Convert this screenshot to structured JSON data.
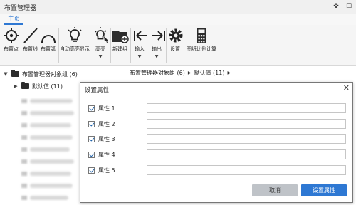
{
  "app": {
    "title": "布置管理器",
    "controls": {
      "pin": "✜",
      "restore": "☐"
    }
  },
  "ribbon_tab": "主页",
  "ribbon": {
    "place_point": "布置点",
    "place_line": "布置线",
    "place_arc": "布置弧",
    "auto_highlight": "自动高亮显示",
    "highlight": "高亮",
    "new_group": "新建组",
    "import": "输入",
    "export": "输出",
    "settings": "设置",
    "drawing_scale": "图纸比例计算",
    "dropdown_glyph": "▼"
  },
  "tree": {
    "root_label": "布置管理器对象组 (6)",
    "child_label": "默认值 (11)",
    "expanded_glyph": "▼",
    "collapsed_glyph": "▶"
  },
  "breadcrumb": {
    "segments": [
      "布置管理器对象组 (6)",
      "默认值 (11)"
    ],
    "separator": "▶"
  },
  "dialog": {
    "title": "设置属性",
    "close": "✕",
    "properties": [
      {
        "label": "属性 1",
        "checked": true,
        "value": ""
      },
      {
        "label": "属性 2",
        "checked": true,
        "value": ""
      },
      {
        "label": "属性 3",
        "checked": true,
        "value": ""
      },
      {
        "label": "属性 4",
        "checked": true,
        "value": ""
      },
      {
        "label": "属性 5",
        "checked": true,
        "value": ""
      }
    ],
    "cancel_label": "取消",
    "ok_label": "设置属性"
  },
  "colors": {
    "accent": "#2e78d3",
    "cancel_button": "#bfc3c8",
    "folder_icon": "#2d2d2d"
  }
}
